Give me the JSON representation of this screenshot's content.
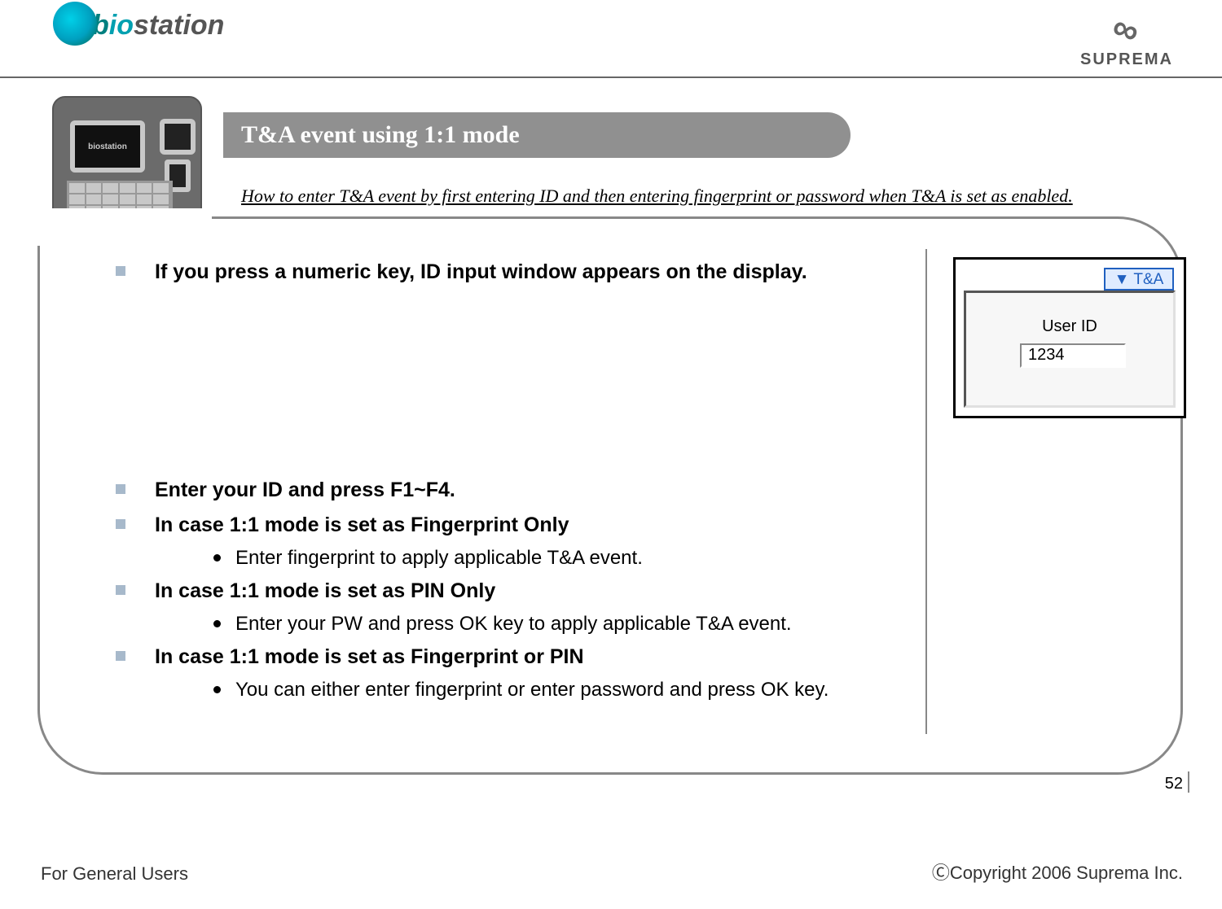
{
  "header": {
    "logo_left_b": "b",
    "logo_left_io": "io",
    "logo_left_rest": "station",
    "logo_left_device_label": "biostation",
    "logo_right": "SUPREMA",
    "infinity": "∞"
  },
  "title_pill": "T&A event using 1:1 mode",
  "subtitle": "How to enter T&A event by first entering ID and then entering fingerprint or password when T&A is set as enabled.",
  "bullets": {
    "b1": "If you press a numeric key, ID input window appears on the display.",
    "b2": "Enter your ID and press F1~F4.",
    "b3": "In case 1:1 mode is set as Fingerprint Only",
    "b3s1": "Enter fingerprint to apply applicable T&A event.",
    "b4": "In case 1:1 mode is set as PIN Only",
    "b4s1": "Enter your PW and press OK key to apply applicable T&A event.",
    "b5": "In case 1:1 mode is set as Fingerprint or PIN",
    "b5s1": "You can either enter fingerprint or enter password and press OK key."
  },
  "mock": {
    "tna_tab": "▼ T&A",
    "user_id_label": "User ID",
    "user_id_value": "1234"
  },
  "footer": {
    "left": "For General Users",
    "right": "ⒸCopyright 2006 Suprema Inc.",
    "page": "52"
  }
}
